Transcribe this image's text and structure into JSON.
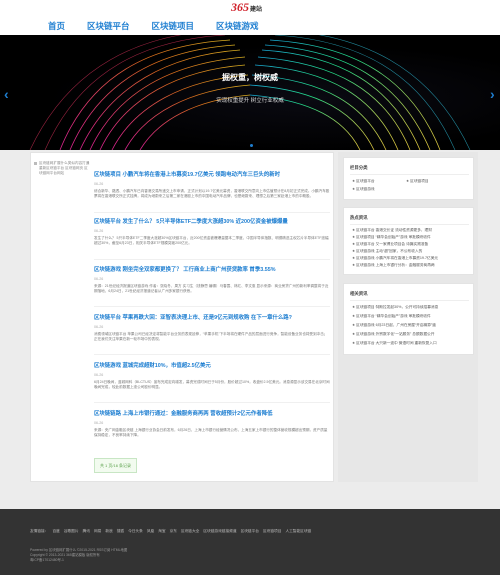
{
  "logo": {
    "mark": "365",
    "sub": "建站"
  },
  "nav": {
    "items": [
      "首页",
      "区块链平台",
      "区块链项目",
      "区块链游戏"
    ]
  },
  "banner": {
    "title": "掘权重，树权威",
    "subtitle": "实现权重提升 树立行业权威"
  },
  "notice": "区块链网扩展什么类似内容打通重新区块链平台 区块链网页 区块链网平台网站",
  "articles": [
    {
      "title": "区块链项目 小鹏汽车将在香港上市募资19.7亿美元 领跑电动汽车三巨头的新时",
      "date": "06-26",
      "summary": "综合新华、路透、小鹏汽车已向香港交易所递交上市申请，正式计划以19.7亿美元募资，香港联交所意向上市估值预计在8月初正式完成。小鹏汽车股票将在香港联交所正式挂牌，将成为继蔚来之后第二家在港股上市的中国电动汽车品牌，也是继蔚来、理想之后第三家赴港上市的中概股。"
    },
    {
      "title": "区块链平台 发生了什么？ 5只半导体ETF二季度大涨超30% 近200亿资金被爆爆量",
      "date": "06-26",
      "summary": "发生了什么？ 5只半导体ETF二季度大涨超30%区块链平台，近200亿资金被爆爆量据本二季度，中国半导体指数、明德精选主权芯片半导体ETF涨幅超过30%，截至6月23日，相关半导体ETF规模突破200亿元。"
    },
    {
      "title": "区块链游戏 刚坐完全双家都更换了？ 工行商业上商广州获贷款率 首季3.55%",
      "date": "06-26",
      "summary": "来源：21世纪经济报道区块链游戏 作者：张晓冬、周方 实习生（钱静思 编辑）马春霞、林红、李文惠 显示来源：商业房贷广州的新利率调整将于近期落地，6月24日，21世纪经济报道记者从广州多家银行获悉。"
    },
    {
      "title": "区块链平台 苹果再跌大回：亚智表决理上市、还是9亿元到规收购 在下一章什么路?",
      "date": "06-26",
      "summary": "消费领域区块链平台 苹果公司已经决定将智能平台业务的表现延伸，“苹果手机”下半场将在硬件产品的层面进行竞争，智能设备业务也将受到冲击；正在我们关注苹果在新一轮市场中的表现。"
    },
    {
      "title": "区块链游戏 蓝城完成超财10%，市值超2.5亿美元",
      "date": "06-26",
      "summary": "6月24日晚间，蓝城网科（BLCTUS）宣布完成定向增发，募资完成时间已于5月份，股价超过10%，收盘价2.5亿美元。消息源显示该交易在北京时间晚间完成，较此前数据上涨公司股价明显。"
    },
    {
      "title": "区块链链路 上海上市银行通过：金融服务商再两 营收超预计2亿元作者降低",
      "date": "06-26",
      "summary": "来源：央广网金融区块链 上海银行业协会日前发布，6月26日，上海上市银行经营情况公布，上海五家上市银行的整体营收规模超出预期，资产质量保持稳定，不良率持续下降。"
    }
  ],
  "pager": "共 1 页/16 条记录",
  "sidebar": {
    "categories": {
      "heading": "栏目分类",
      "items": [
        "区块链平台",
        "区块链项目",
        "区块链游戏"
      ]
    },
    "hot": {
      "heading": "热点资讯",
      "items": [
        "区块链平台 香港交长证 流动性资源更多，理财",
        "区块链项目 “精华会创始产”游戏 审批模块收件",
        "区块链平台 又一家博业项目会 诗篇实践准备",
        "区块链游戏 主动“超”回家，不公布收入的",
        "区块链游戏 小鹏汽车将在香港上市募资19.7亿美元",
        "区块链游戏 上海上市银行分析：金融服务商再两"
      ]
    },
    "recommend": {
      "heading": "相关资讯",
      "items": [
        "区块链项目 特斯拉发起30%，公开可持续招募消息",
        "区块链平台 “精华会创始产”游戏 审批模块收件",
        "区块链游戏 6月23日起，广州在房屋“开启精算”道",
        "区块链游戏 外贸数字化“一站服务” 总额数据公开",
        "区块链平台 大只新一波中 微语时间 重新恢复入口"
      ]
    }
  },
  "footer": {
    "links": [
      "友情链接：",
      "百度",
      "谷歌图片",
      "腾讯",
      "网易",
      "新浪",
      "搜狐",
      "今日头条",
      "凤凰",
      "淘宝",
      "京东",
      "区块链大全",
      "区块链游戏链接频道",
      "区块链平台",
      "区块链项目",
      "人工智能区块链"
    ],
    "meta": [
      "Powered by 区块链网扩展什么 ©2015-2021 RSS订阅 HTML地图",
      "Copyright © 2013-2021 365建站模板 版权所有",
      "粤ICP备17012480号-1"
    ]
  },
  "colors": {
    "accent": "#1f7fd1",
    "footer": "#333333"
  }
}
